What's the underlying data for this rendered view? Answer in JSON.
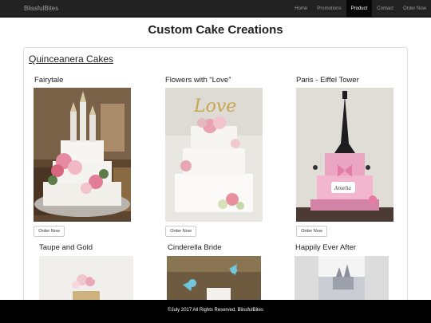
{
  "navbar": {
    "brand": "BlissfulBites",
    "links": [
      {
        "label": "Home",
        "active": false
      },
      {
        "label": "Promotions",
        "active": false
      },
      {
        "label": "Product",
        "active": true
      },
      {
        "label": "Contact",
        "active": false
      },
      {
        "label": "Order Now",
        "active": false
      }
    ]
  },
  "page": {
    "title": "Custom Cake Creations"
  },
  "section": {
    "title": "Quinceanera Cakes",
    "order_label": "Order Now",
    "cakes": [
      {
        "name": "Fairytale"
      },
      {
        "name": "Flowers with “Love”"
      },
      {
        "name": "Paris - Eiffel Tower"
      },
      {
        "name": "Taupe and Gold"
      },
      {
        "name": "Cinderella Bride"
      },
      {
        "name": "Happily Ever After"
      }
    ]
  },
  "footer": {
    "text": "©July 2017 All Rights Reserved. BlissfulBites"
  },
  "colors": {
    "navbar": "#222222",
    "footer": "#000000",
    "active_tab": "#080808"
  }
}
